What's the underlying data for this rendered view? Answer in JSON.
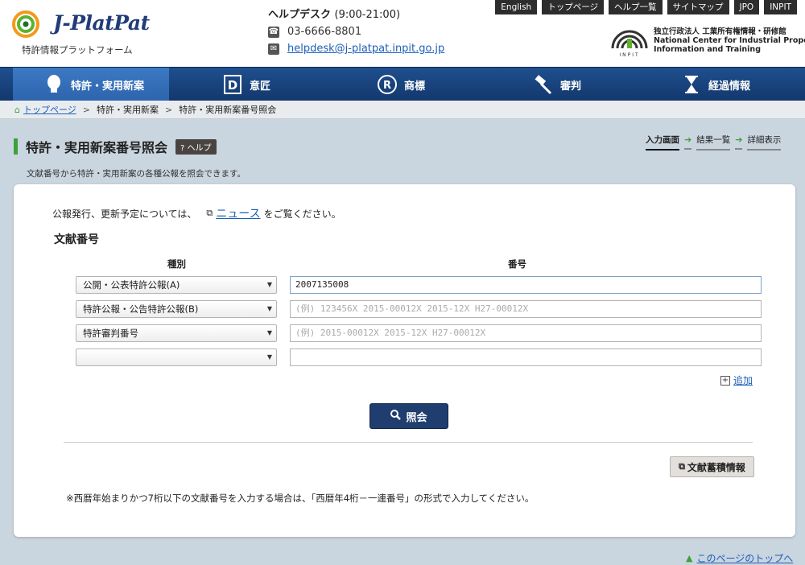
{
  "header": {
    "logo_text": "J-PlatPat",
    "logo_sub": "特許情報プラットフォーム",
    "helpdesk_title": "ヘルプデスク",
    "helpdesk_hours": "(9:00-21:00)",
    "phone": "03-6666-8801",
    "email": "helpdesk@j-platpat.inpit.go.jp",
    "top_links": [
      "English",
      "トップページ",
      "ヘルプ一覧",
      "サイトマップ",
      "JPO",
      "INPIT"
    ],
    "inpit_lines": [
      "独立行政法人 工業所有権情報・研修館",
      "National Center for Industrial Property",
      "Information and Training"
    ],
    "inpit_mark": "INPIT"
  },
  "nav": {
    "items": [
      {
        "label": "特許・実用新案",
        "icon": "lightbulb-icon"
      },
      {
        "label": "意匠",
        "icon": "design-d-icon"
      },
      {
        "label": "商標",
        "icon": "trademark-r-icon"
      },
      {
        "label": "審判",
        "icon": "gavel-icon"
      },
      {
        "label": "経過情報",
        "icon": "hourglass-icon"
      }
    ]
  },
  "breadcrumb": [
    "トップページ",
    "特許・実用新案",
    "特許・実用新案番号照会"
  ],
  "page": {
    "title": "特許・実用新案番号照会",
    "help_label": "ヘルプ",
    "steps": [
      "入力画面",
      "結果一覧",
      "詳細表示"
    ],
    "description": "文献番号から特許・実用新案の各種公報を照会できます。"
  },
  "form": {
    "notice_before": "公報発行、更新予定については、",
    "notice_link": "ニュース",
    "notice_after": "をご覧ください。",
    "section_title": "文献番号",
    "col_type": "種別",
    "col_number": "番号",
    "rows": [
      {
        "type": "公開・公表特許公報(A)",
        "value": "2007135008",
        "placeholder": ""
      },
      {
        "type": "特許公報・公告特許公報(B)",
        "value": "",
        "placeholder": "(例) 123456X 2015-00012X 2015-12X H27-00012X"
      },
      {
        "type": "特許審判番号",
        "value": "",
        "placeholder": "(例) 2015-00012X 2015-12X H27-00012X"
      },
      {
        "type": "",
        "value": "",
        "placeholder": ""
      }
    ],
    "add_label": "追加",
    "search_label": "照会",
    "bunken_label": "文献蓄積情報",
    "note": "※西暦年始まりかつ7桁以下の文献番号を入力する場合は、「西暦年4桁－一連番号」の形式で入力してください。"
  },
  "footer": {
    "to_top": "このページのトップへ"
  },
  "colors": {
    "nav": "#1a4480",
    "nav_active": "#3470b8",
    "accent_green": "#3da13a",
    "link": "#1d5fb7"
  }
}
